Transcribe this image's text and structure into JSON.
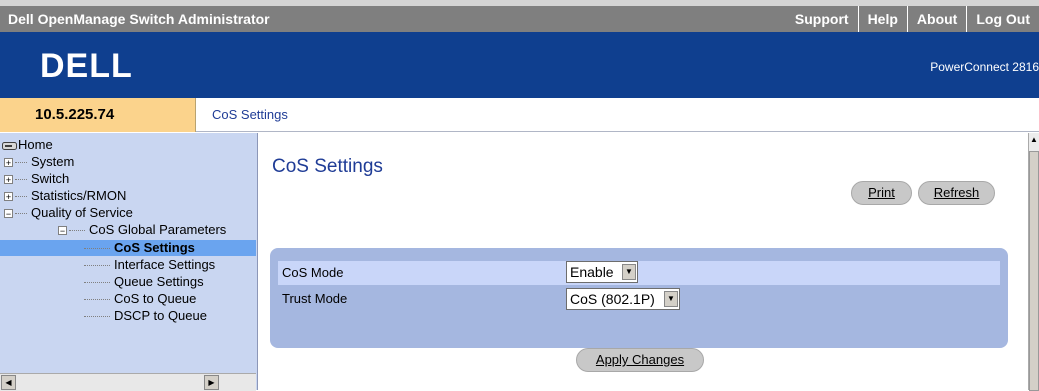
{
  "topbar": {
    "app_title": "Dell OpenManage Switch Administrator",
    "links": [
      "Support",
      "Help",
      "About",
      "Log Out"
    ]
  },
  "banner": {
    "logo_text": "DELL",
    "model": "PowerConnect 2816"
  },
  "ip_address": "10.5.225.74",
  "breadcrumb": "CoS Settings",
  "sidebar": {
    "home": "Home",
    "items": [
      {
        "label": "System"
      },
      {
        "label": "Switch"
      },
      {
        "label": "Statistics/RMON"
      },
      {
        "label": "Quality of Service"
      },
      {
        "label": "CoS Global Parameters"
      },
      {
        "label": "CoS Settings"
      },
      {
        "label": "Interface Settings"
      },
      {
        "label": "Queue Settings"
      },
      {
        "label": "CoS to Queue"
      },
      {
        "label": "DSCP to Queue"
      }
    ]
  },
  "main": {
    "title": "CoS Settings",
    "print_label": "Print",
    "refresh_label": "Refresh",
    "fields": {
      "cos_mode_label": "CoS Mode",
      "cos_mode_value": "Enable",
      "trust_mode_label": "Trust Mode",
      "trust_mode_value": "CoS (802.1P)"
    },
    "apply_label": "Apply Changes"
  },
  "colors": {
    "banner": "#0f3f8f",
    "sidebar": "#c9d6f1",
    "accent_text": "#1f3c96",
    "ip_bg": "#fbd38c"
  }
}
